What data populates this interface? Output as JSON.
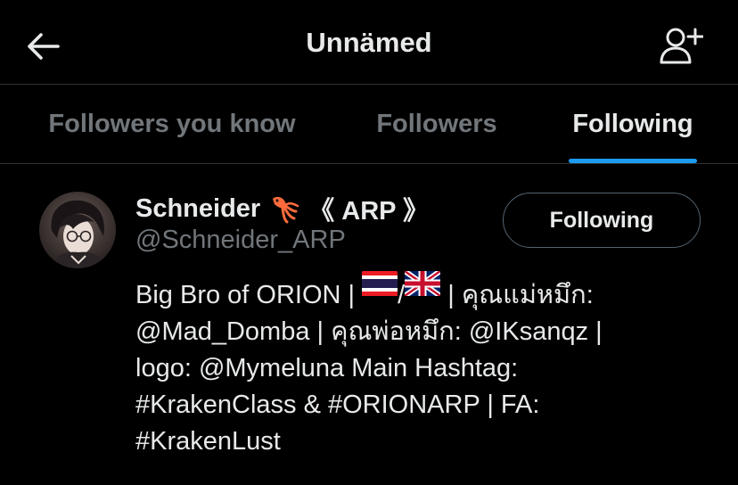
{
  "header": {
    "title": "Unnämed",
    "back_icon": "arrow-left-icon",
    "add_icon": "add-user-icon"
  },
  "tabs": [
    {
      "label": "Followers you know",
      "active": false
    },
    {
      "label": "Followers",
      "active": false
    },
    {
      "label": "Following",
      "active": true
    }
  ],
  "user": {
    "name": "Schneider",
    "name_suffix": "《 ARP 》",
    "name_emoji": "squid-icon",
    "handle": "@Schneider_ARP",
    "follow_button": "Following",
    "bio": {
      "line1_a": "Big Bro of ORION |",
      "line1_b": "/",
      "line1_c": "| คุณแม่หมึก:",
      "line2": "@Mad_Domba | คุณพ่อหมึก: @IKsanqz |",
      "line3": "logo: @Mymeluna Main Hashtag:",
      "line4": "#KrakenClass & #ORIONARP | FA:",
      "line5": "#KrakenLust",
      "flags": [
        "thailand-flag-icon",
        "uk-flag-icon"
      ]
    }
  },
  "colors": {
    "background": "#000000",
    "text": "#e7e9ea",
    "muted": "#71767b",
    "accent": "#1d9bf0",
    "divider": "#2f3336"
  }
}
